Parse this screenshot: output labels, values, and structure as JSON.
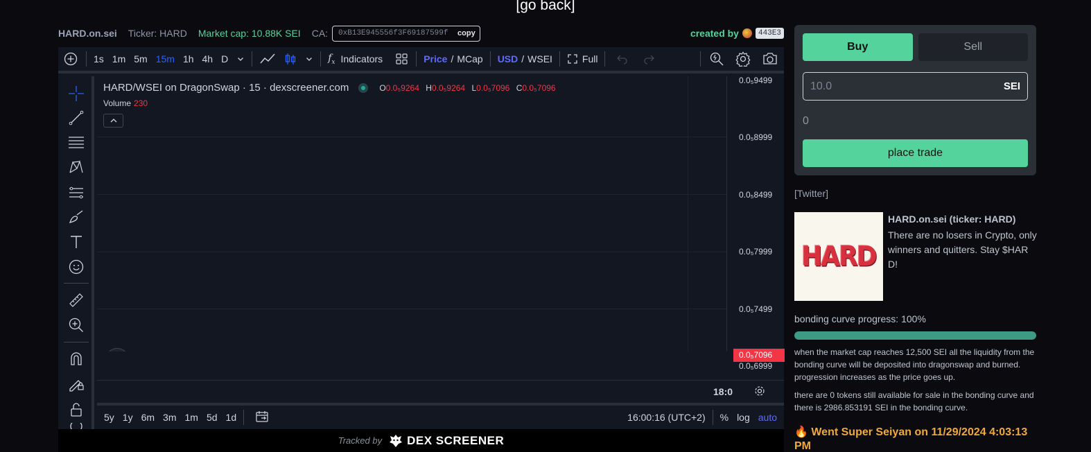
{
  "header": {
    "go_back": "[go back]"
  },
  "info": {
    "name": "HARD.on.sei",
    "ticker": "Ticker: HARD",
    "market_cap": "Market cap: 10.88K SEI",
    "ca_label": "CA:",
    "ca_value": "0xB13E945556f3F69187599f",
    "copy": "copy",
    "created_by": "created by",
    "creator": "443E3"
  },
  "chart": {
    "timeframes": [
      "1s",
      "1m",
      "5m",
      "15m",
      "1h",
      "4h",
      "D"
    ],
    "active_timeframe": "15m",
    "indicators": "Indicators",
    "price": "Price",
    "mcap": "MCap",
    "usd": "USD",
    "wsei": "WSEI",
    "full": "Full",
    "symbol": "HARD/WSEI on DragonSwap · 15 · dexscreener.com",
    "ohlc": {
      "o": "0.0₅9264",
      "h": "0.0₅9264",
      "l": "0.0₅7096",
      "c": "0.0₅7096"
    },
    "volume_label": "Volume",
    "volume_value": "230",
    "price_ticks": [
      "0.0₅9499",
      "0.0₅8999",
      "0.0₅8499",
      "0.0₅7999",
      "0.0₅7499",
      "0.0₅6999"
    ],
    "last_price": "0.0₅7096",
    "time_label": "18:0",
    "ranges": [
      "5y",
      "1y",
      "6m",
      "3m",
      "1m",
      "5d",
      "1d"
    ],
    "clock": "16:00:16 (UTC+2)",
    "pct": "%",
    "log": "log",
    "auto": "auto"
  },
  "chart_data": {
    "type": "bar",
    "categories": [
      "18:00"
    ],
    "series": [
      {
        "open": 9.264e-07,
        "high": 9.264e-07,
        "low": 7.096e-07,
        "close": 7.096e-07
      }
    ],
    "volume": [
      230
    ],
    "ylim": [
      6.999e-07,
      9.499e-07
    ]
  },
  "footer": {
    "tracked_by": "Tracked by",
    "brand": "DEX SCREENER"
  },
  "trade": {
    "buy": "Buy",
    "sell": "Sell",
    "amount_placeholder": "10.0",
    "unit": "SEI",
    "receive": "0",
    "place_trade": "place trade"
  },
  "token": {
    "twitter": "[Twitter]",
    "image_text": "HARD",
    "title": "HARD.on.sei (ticker: HARD)",
    "description": "There are no losers in Crypto, only winners and quitters. Stay $HARD!"
  },
  "progress": {
    "label": "bonding curve progress: 100%",
    "value": 1.0,
    "note1": "when the market cap reaches 12,500 SEI all the liquidity from the bonding curve will be deposited into dragonswap and burned. progression increases as the price goes up.",
    "note2": "there are 0 tokens still available for sale in the bonding curve and there is 2986.853191 SEI in the bonding curve.",
    "seiyan": "🔥 Went Super Seiyan on 11/29/2024 4:03:13 PM"
  },
  "colors": {
    "accent": "#54d39c",
    "down": "#f23645",
    "blue": "#5d6bff"
  }
}
